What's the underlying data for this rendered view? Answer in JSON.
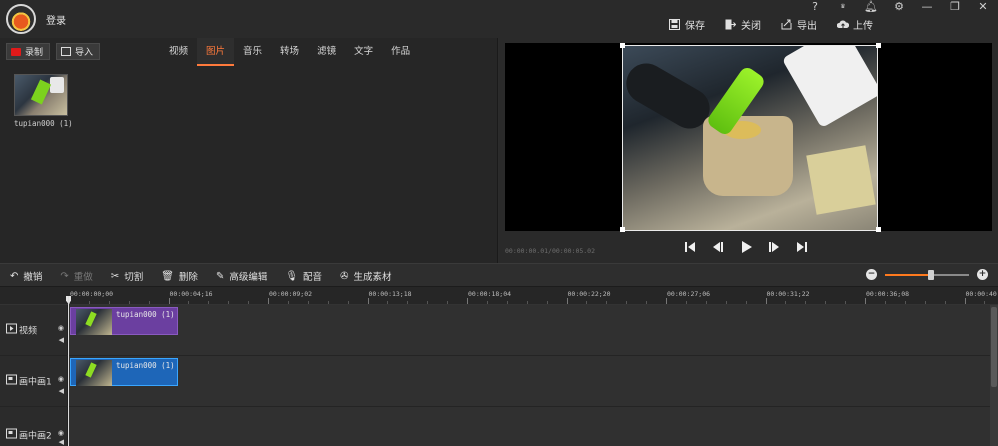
{
  "titlebar": {
    "login_label": "登录",
    "actions": [
      {
        "name": "save",
        "label": "保存",
        "icon": "save-icon"
      },
      {
        "name": "close",
        "label": "关闭",
        "icon": "exit-icon"
      },
      {
        "name": "export",
        "label": "导出",
        "icon": "export-icon"
      },
      {
        "name": "upload",
        "label": "上传",
        "icon": "cloud-upload-icon"
      }
    ],
    "window": {
      "help": "?",
      "vip": "VIP",
      "minimize": "—",
      "restore": "❐",
      "close": "✕"
    }
  },
  "library": {
    "record_label": "录制",
    "import_label": "导入",
    "tabs": [
      "视频",
      "图片",
      "音乐",
      "转场",
      "滤镜",
      "文字",
      "作品"
    ],
    "active_tab": "图片",
    "items": [
      {
        "label": "tupian000 (1)"
      }
    ]
  },
  "preview": {
    "timecode": "00:00:00.01/00:00:05.02"
  },
  "edit_toolbar": {
    "items": [
      {
        "label": "撤销",
        "icon": "undo-icon",
        "enabled": true
      },
      {
        "label": "重做",
        "icon": "redo-icon",
        "enabled": false
      },
      {
        "label": "切割",
        "icon": "scissors-icon",
        "enabled": true
      },
      {
        "label": "删除",
        "icon": "trash-icon",
        "enabled": true
      },
      {
        "label": "高级编辑",
        "icon": "pencil-icon",
        "enabled": true
      },
      {
        "label": "配音",
        "icon": "microphone-icon",
        "enabled": true
      },
      {
        "label": "生成素材",
        "icon": "film-reel-icon",
        "enabled": true
      }
    ],
    "zoom_level": 0.55
  },
  "timeline": {
    "ruler_labels": [
      "00:00:00;00",
      "00:00:04;16",
      "00:00:09;02",
      "00:00:13;18",
      "00:00:18;04",
      "00:00:22;20",
      "00:00:27;06",
      "00:00:31;22",
      "00:00:36;08",
      "00:00:40"
    ],
    "tracks": [
      {
        "name": "视频",
        "clip": "tupian000 (1)"
      },
      {
        "name": "画中画1",
        "clip": "tupian000 (1)"
      },
      {
        "name": "画中画2",
        "clip": ""
      }
    ]
  },
  "colors": {
    "accent": "#ff7a3c",
    "record": "#e01a1a",
    "video_clip": "#6b3fa0",
    "pip_clip": "#1e66b8"
  }
}
